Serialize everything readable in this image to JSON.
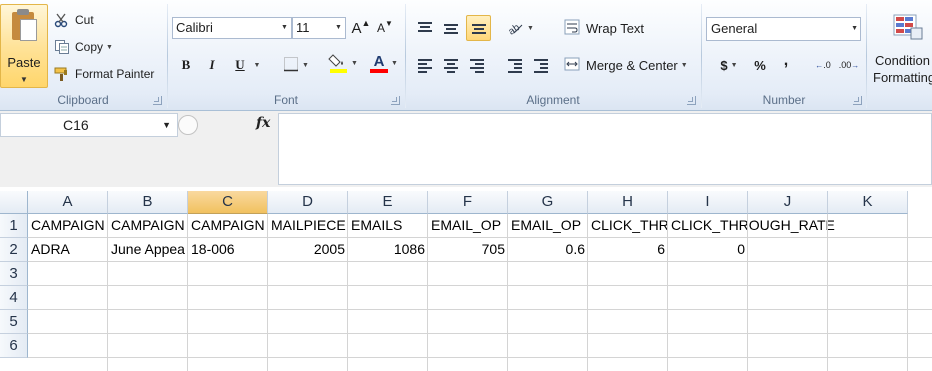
{
  "clipboard": {
    "paste_label": "Paste",
    "cut_label": "Cut",
    "copy_label": "Copy",
    "format_painter_label": "Format Painter",
    "group_label": "Clipboard"
  },
  "font": {
    "name": "Calibri",
    "size": "11",
    "grow_label": "A",
    "shrink_label": "A",
    "bold_label": "B",
    "italic_label": "I",
    "underline_label": "U",
    "font_color_label": "A",
    "group_label": "Font",
    "highlight_color": "#ffff00",
    "font_color": "#ff0000"
  },
  "alignment": {
    "wrap_text_label": "Wrap Text",
    "merge_center_label": "Merge & Center",
    "group_label": "Alignment"
  },
  "number": {
    "format": "General",
    "currency_label": "$",
    "percent_label": "%",
    "comma_label": ",",
    "inc_decimal_label": ".0",
    "dec_decimal_label": ".00",
    "group_label": "Number"
  },
  "styles": {
    "conditional_line1": "Condition",
    "conditional_line2": "Formatting"
  },
  "formula_bar": {
    "name_box": "C16",
    "fx_label": "fx",
    "content": ""
  },
  "sheet": {
    "columns": [
      "A",
      "B",
      "C",
      "D",
      "E",
      "F",
      "G",
      "H",
      "I",
      "J",
      "K"
    ],
    "selected_column": "C",
    "rows": [
      "1",
      "2",
      "3",
      "4",
      "5",
      "6"
    ],
    "row1": [
      "CAMPAIGN",
      "CAMPAIGN",
      "CAMPAIGN",
      "MAILPIECE",
      "EMAILS",
      "EMAIL_OP",
      "EMAIL_OP",
      "CLICK_THR",
      "CLICK_THROUGH_RATE"
    ],
    "row2": [
      "ADRA",
      "June Appea",
      "18-006",
      "2005",
      "1086",
      "705",
      "0.6",
      "6",
      "0"
    ]
  }
}
